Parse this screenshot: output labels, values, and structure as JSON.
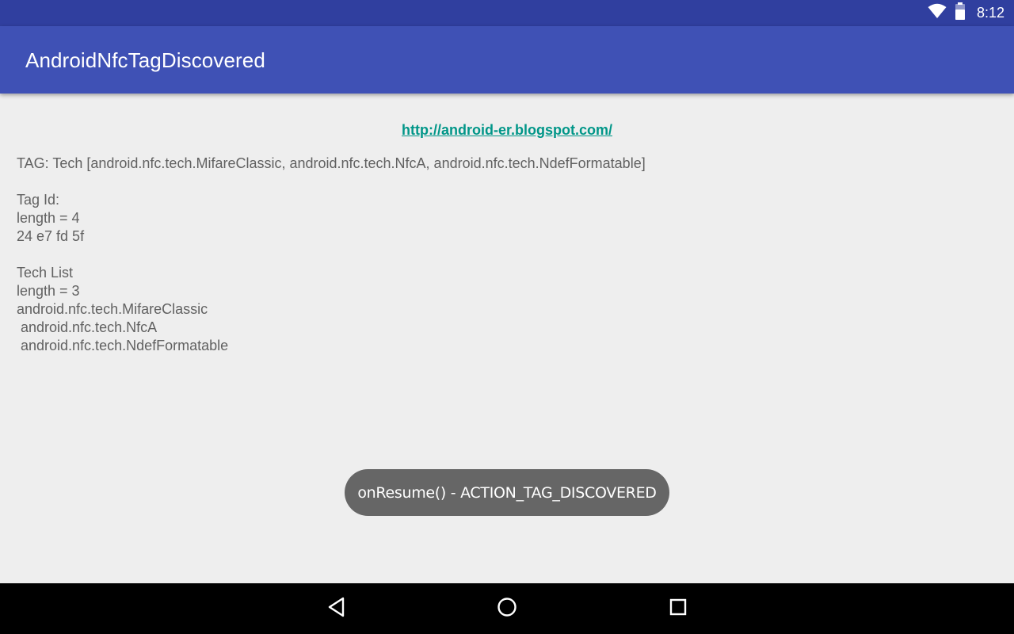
{
  "status_bar": {
    "time": "8:12",
    "icons": [
      "wifi-icon",
      "battery-icon"
    ]
  },
  "app_bar": {
    "title": "AndroidNfcTagDiscovered"
  },
  "content": {
    "link_text": "http://android-er.blogspot.com/",
    "info_text": "TAG: Tech [android.nfc.tech.MifareClassic, android.nfc.tech.NfcA, android.nfc.tech.NdefFormatable]\n\nTag Id:\nlength = 4\n24 e7 fd 5f\n\nTech List\nlength = 3\nandroid.nfc.tech.MifareClassic\n android.nfc.tech.NfcA\n android.nfc.tech.NdefFormatable"
  },
  "toast": {
    "message": "onResume() - ACTION_TAG_DISCOVERED"
  },
  "nav_bar": {
    "buttons": [
      "back-icon",
      "home-icon",
      "recents-icon"
    ]
  },
  "colors": {
    "status_bar": "#303f9f",
    "app_bar": "#3f51b5",
    "link": "#009688",
    "background": "#eeeeee",
    "toast": "#666666"
  }
}
